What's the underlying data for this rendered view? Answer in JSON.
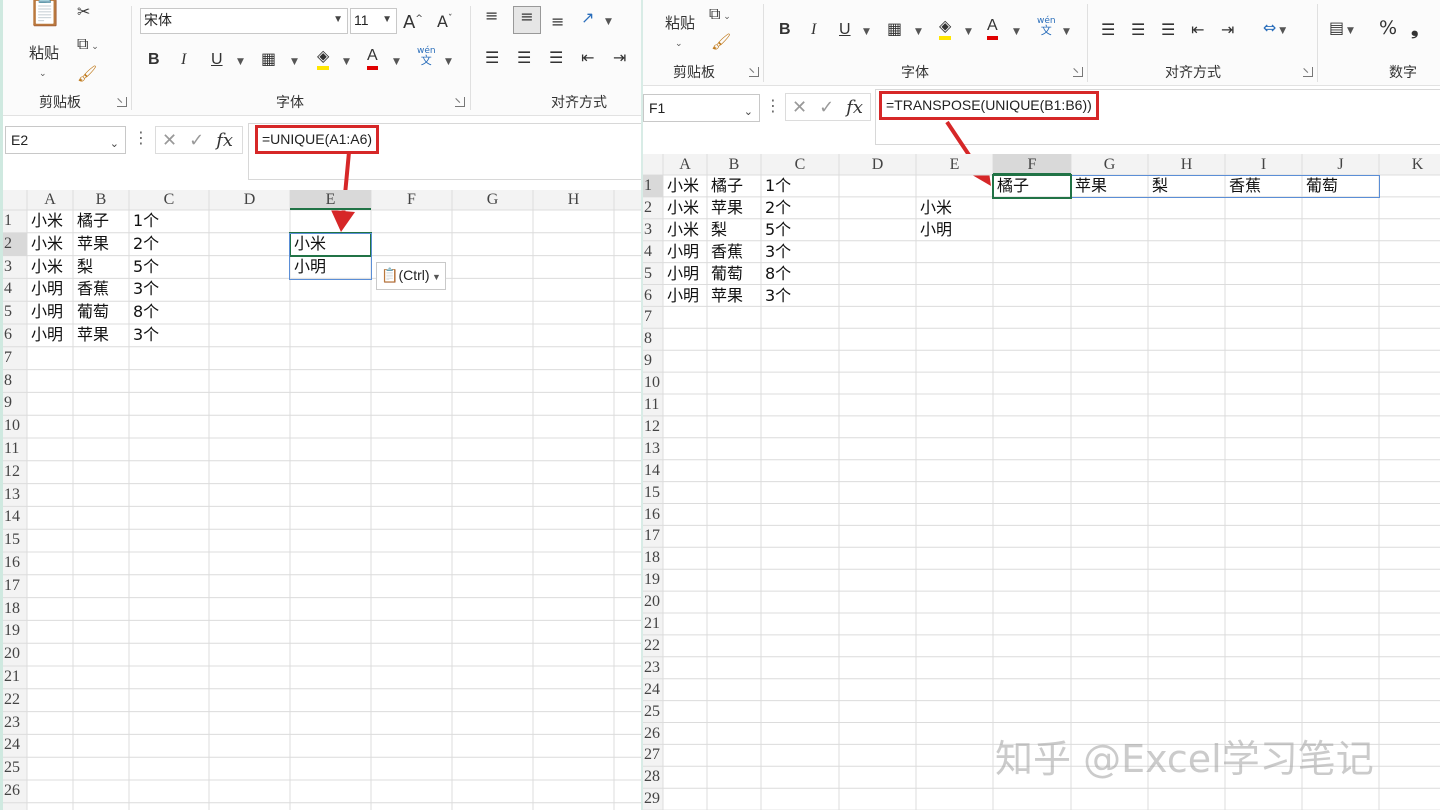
{
  "left": {
    "clipboard": {
      "paste": "粘贴",
      "group": "剪贴板"
    },
    "font": {
      "name": "宋体",
      "size": "11",
      "group": "字体",
      "bold": "B",
      "italic": "I",
      "underline": "U",
      "grow": "A",
      "shrink": "A",
      "wen": "wén",
      "wen_sub": "文"
    },
    "align": {
      "group": "对齐方式"
    },
    "name_box": "E2",
    "formula": "=UNIQUE(A1:A6)",
    "columns": [
      "A",
      "B",
      "C",
      "D",
      "E",
      "F",
      "G",
      "H"
    ],
    "row_count": 26,
    "rows": [
      [
        "小米",
        "橘子",
        "1个"
      ],
      [
        "小米",
        "苹果",
        "2个"
      ],
      [
        "小米",
        "梨",
        "5个"
      ],
      [
        "小明",
        "香蕉",
        "3个"
      ],
      [
        "小明",
        "葡萄",
        "8个"
      ],
      [
        "小明",
        "苹果",
        "3个"
      ]
    ],
    "result_cells": [
      "小米",
      "小明"
    ],
    "paste_options": "(Ctrl)"
  },
  "right": {
    "clipboard": {
      "paste": "粘贴",
      "group": "剪贴板"
    },
    "font": {
      "group": "字体",
      "bold": "B",
      "italic": "I",
      "underline": "U",
      "wen": "wén",
      "wen_sub": "文"
    },
    "align": {
      "group": "对齐方式"
    },
    "number": {
      "group": "数字",
      "percent": "%",
      "comma": "❟"
    },
    "name_box": "F1",
    "formula": "=TRANSPOSE(UNIQUE(B1:B6))",
    "columns": [
      "A",
      "B",
      "C",
      "D",
      "E",
      "F",
      "G",
      "H",
      "I",
      "J",
      "K"
    ],
    "row_count": 29,
    "rows": [
      [
        "小米",
        "橘子",
        "1个"
      ],
      [
        "小米",
        "苹果",
        "2个"
      ],
      [
        "小米",
        "梨",
        "5个"
      ],
      [
        "小明",
        "香蕉",
        "3个"
      ],
      [
        "小明",
        "葡萄",
        "8个"
      ],
      [
        "小明",
        "苹果",
        "3个"
      ]
    ],
    "e_cells": [
      "小米",
      "小明"
    ],
    "transpose_result": [
      "橘子",
      "苹果",
      "梨",
      "香蕉",
      "葡萄"
    ]
  },
  "watermark": "知乎 @Excel学习笔记",
  "colors": {
    "highlight_border": "#d62728",
    "select_green": "#217346"
  }
}
